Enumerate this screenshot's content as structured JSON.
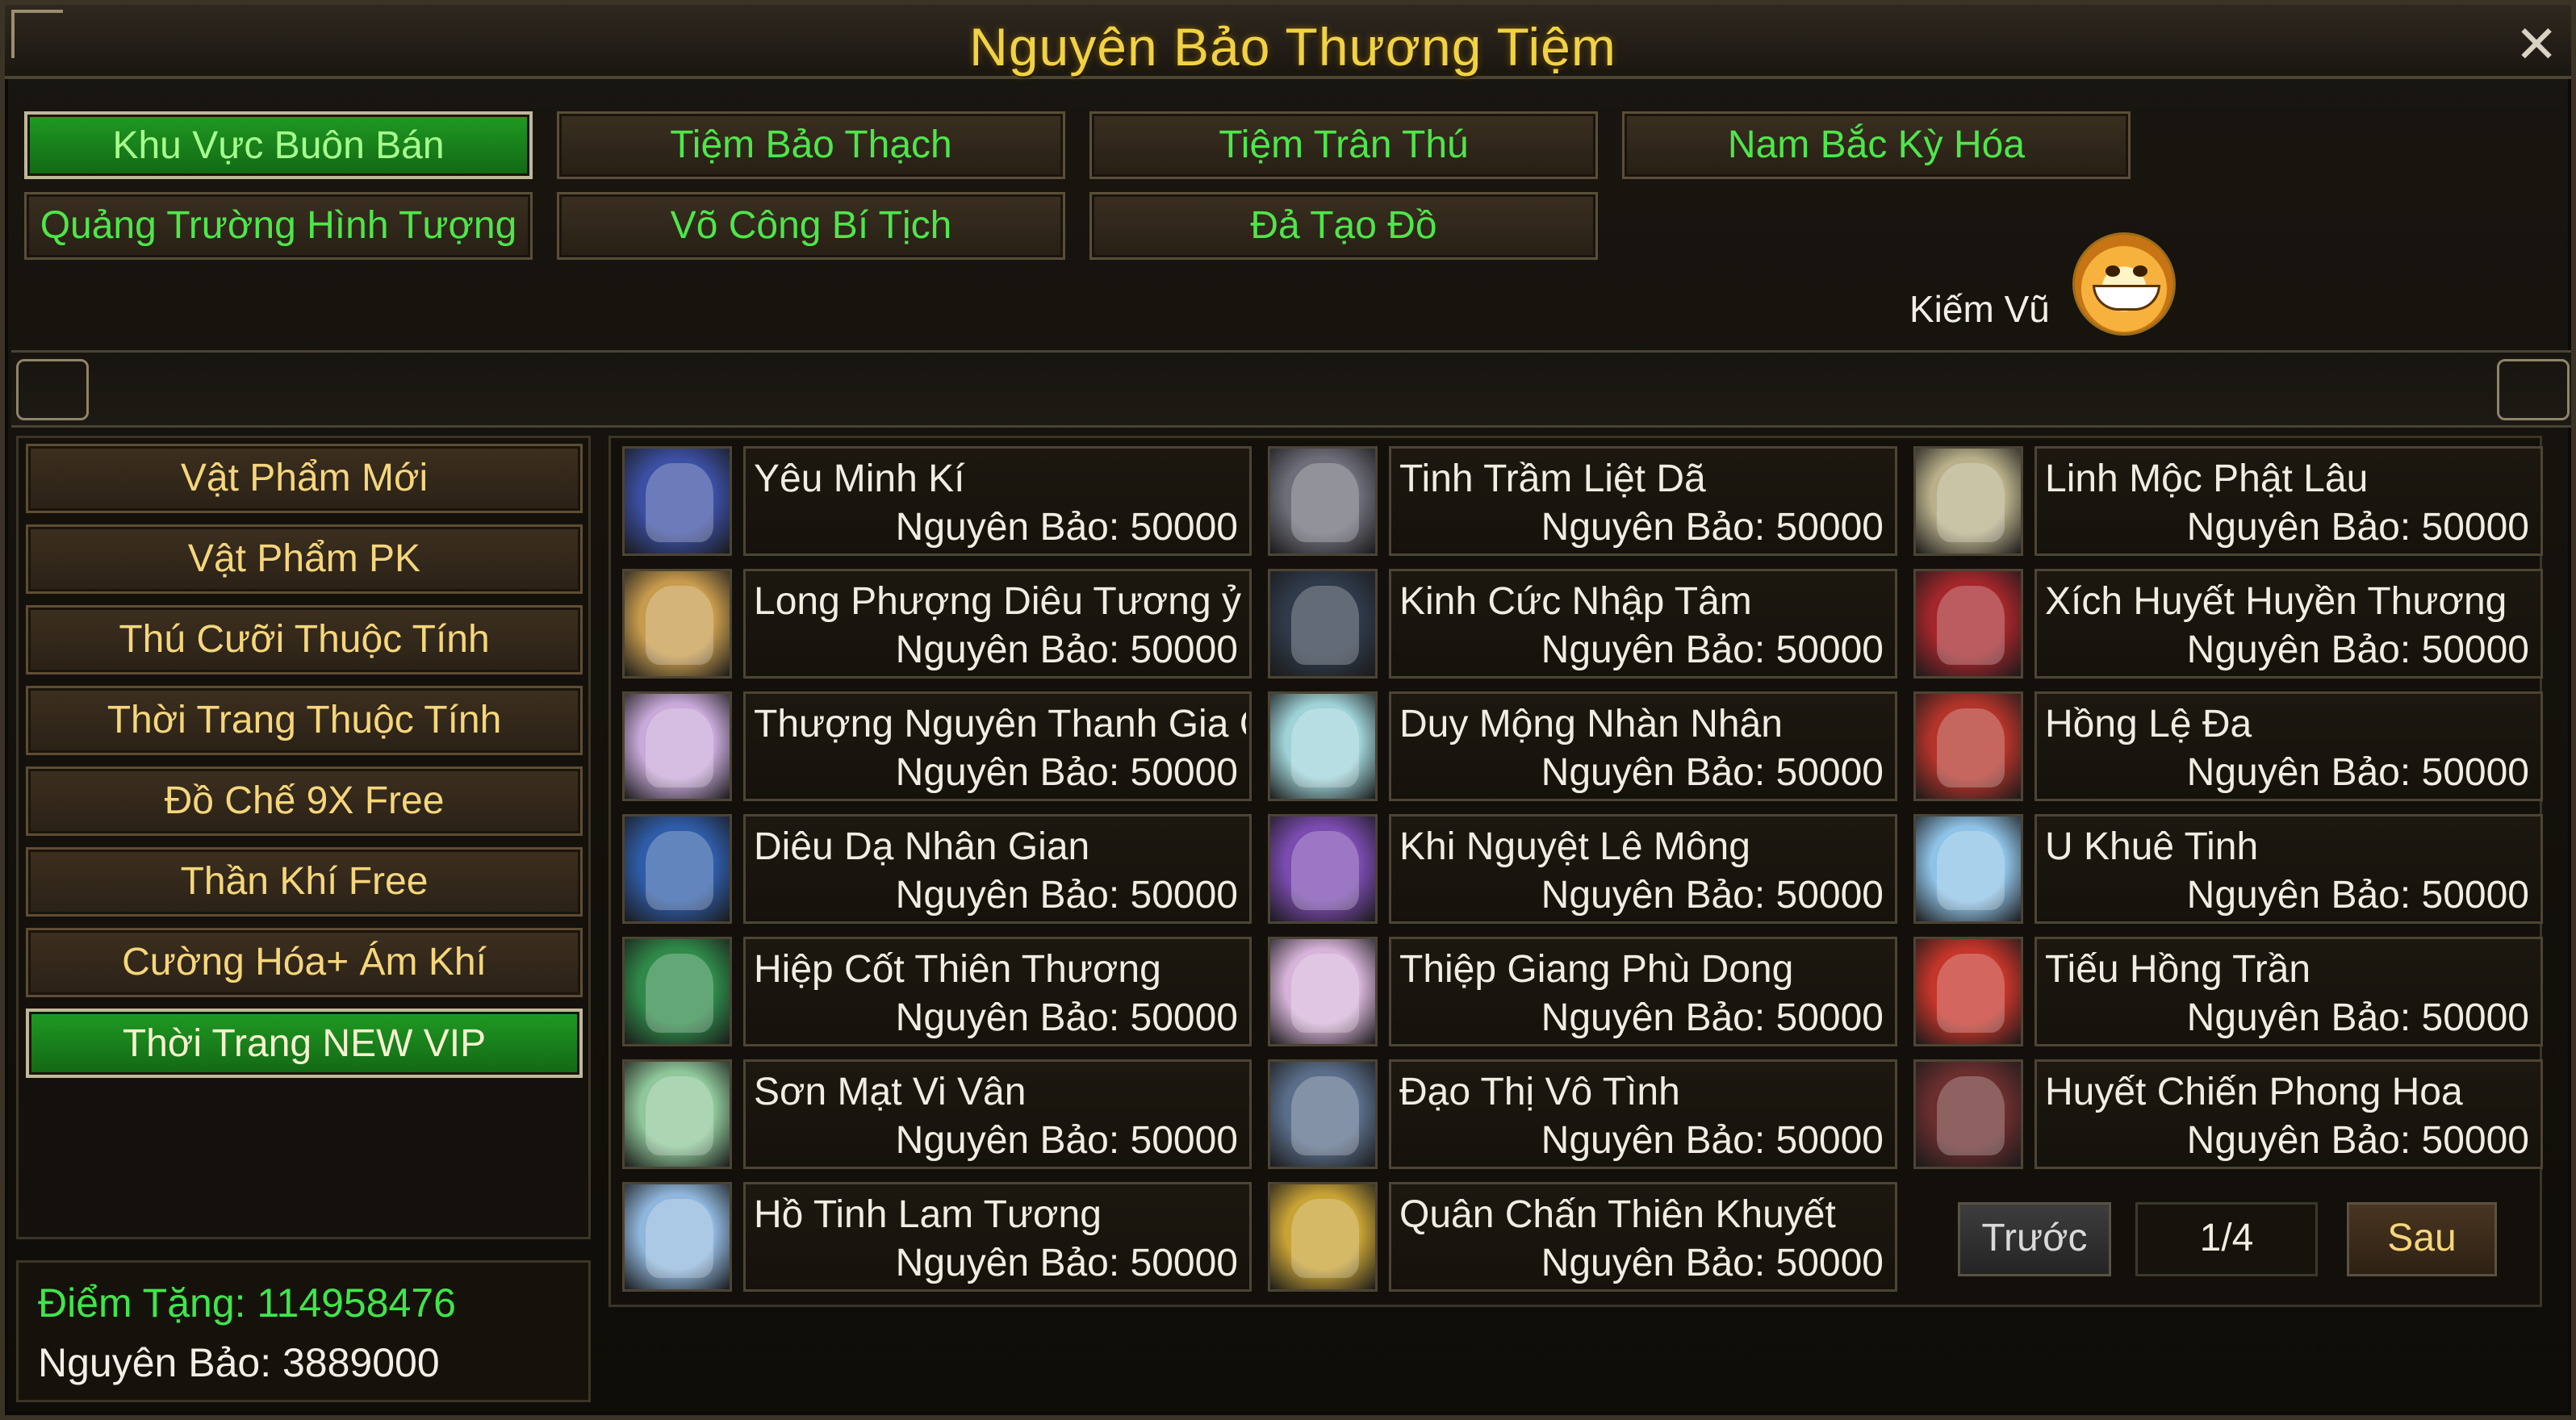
{
  "window": {
    "title": "Nguyên Bảo Thương Tiệm"
  },
  "tabs": [
    {
      "label": "Khu Vực Buôn Bán",
      "active": true
    },
    {
      "label": "Tiệm Bảo Thạch",
      "active": false
    },
    {
      "label": "Tiệm Trân Thú",
      "active": false
    },
    {
      "label": "Nam Bắc Kỳ Hóa",
      "active": false
    },
    {
      "label": "Quảng Trường Hình Tượng",
      "active": false
    },
    {
      "label": "Võ Công Bí Tịch",
      "active": false
    },
    {
      "label": "Đả Tạo Đồ",
      "active": false
    }
  ],
  "user": {
    "name": "Kiếm Vũ"
  },
  "categories": [
    {
      "label": "Vật Phẩm Mới",
      "active": false
    },
    {
      "label": "Vật Phẩm PK",
      "active": false
    },
    {
      "label": "Thú Cưỡi Thuộc Tính",
      "active": false
    },
    {
      "label": "Thời Trang Thuộc Tính",
      "active": false
    },
    {
      "label": "Đồ Chế 9X Free",
      "active": false
    },
    {
      "label": "Thần Khí Free",
      "active": false
    },
    {
      "label": "Cường Hóa+ Ám Khí",
      "active": false
    },
    {
      "label": "Thời Trang NEW VIP",
      "active": true
    }
  ],
  "items": [
    {
      "name": "Yêu Minh Kí",
      "price": "Nguyên Bảo: 50000",
      "color": "#3b4fa3"
    },
    {
      "name": "Tinh Trầm Liệt Dã",
      "price": "Nguyên Bảo: 50000",
      "color": "#6e6e7a"
    },
    {
      "name": "Linh Mộc Phật Lâu",
      "price": "Nguyên Bảo: 50000",
      "color": "#b9b08a"
    },
    {
      "name": "Long Phượng Diêu Tương ỷ",
      "price": "Nguyên Bảo: 50000",
      "color": "#c79b4d"
    },
    {
      "name": "Kinh Cức Nhập Tâm",
      "price": "Nguyên Bảo: 50000",
      "color": "#2f3a4a"
    },
    {
      "name": "Xích Huyết Huyền Thương",
      "price": "Nguyên Bảo: 50000",
      "color": "#a3262b"
    },
    {
      "name": "Thượng Nguyên Thanh Gia C",
      "price": "Nguyên Bảo: 50000",
      "color": "#c8a9d9"
    },
    {
      "name": "Duy Mộng Nhàn Nhân",
      "price": "Nguyên Bảo: 50000",
      "color": "#9fd3d8"
    },
    {
      "name": "Hồng Lệ Đa",
      "price": "Nguyên Bảo: 50000",
      "color": "#b3342a"
    },
    {
      "name": "Diêu Dạ Nhân Gian",
      "price": "Nguyên Bảo: 50000",
      "color": "#2f5ca8"
    },
    {
      "name": "Khi Nguyệt Lê Mông",
      "price": "Nguyên Bảo: 50000",
      "color": "#7b4bb0"
    },
    {
      "name": "U Khuê Tinh",
      "price": "Nguyên Bảo: 50000",
      "color": "#8ec2e6"
    },
    {
      "name": "Hiệp Cốt Thiên Thương",
      "price": "Nguyên Bảo: 50000",
      "color": "#2f8a4a"
    },
    {
      "name": "Thiệp Giang Phù Dong",
      "price": "Nguyên Bảo: 50000",
      "color": "#d6b3d8"
    },
    {
      "name": "Tiếu Hồng Trần",
      "price": "Nguyên Bảo: 50000",
      "color": "#c4352a"
    },
    {
      "name": "Sơn Mạt Vi Vân",
      "price": "Nguyên Bảo: 50000",
      "color": "#8fc79a"
    },
    {
      "name": "Đạo Thị Vô Tình",
      "price": "Nguyên Bảo: 50000",
      "color": "#5a6e8a"
    },
    {
      "name": "Huyết Chiến Phong Hoa",
      "price": "Nguyên Bảo: 50000",
      "color": "#6a2e2e"
    },
    {
      "name": "Hồ Tinh Lam Tương",
      "price": "Nguyên Bảo: 50000",
      "color": "#8fb6dc"
    },
    {
      "name": "Quân Chấn Thiên Khuyết",
      "price": "Nguyên Bảo: 50000",
      "color": "#c7a235"
    }
  ],
  "pagination": {
    "prev": "Trước",
    "page": "1/4",
    "next": "Sau"
  },
  "account": {
    "points": "Điểm Tặng: 114958476",
    "ingots": "Nguyên Bảo: 3889000"
  }
}
